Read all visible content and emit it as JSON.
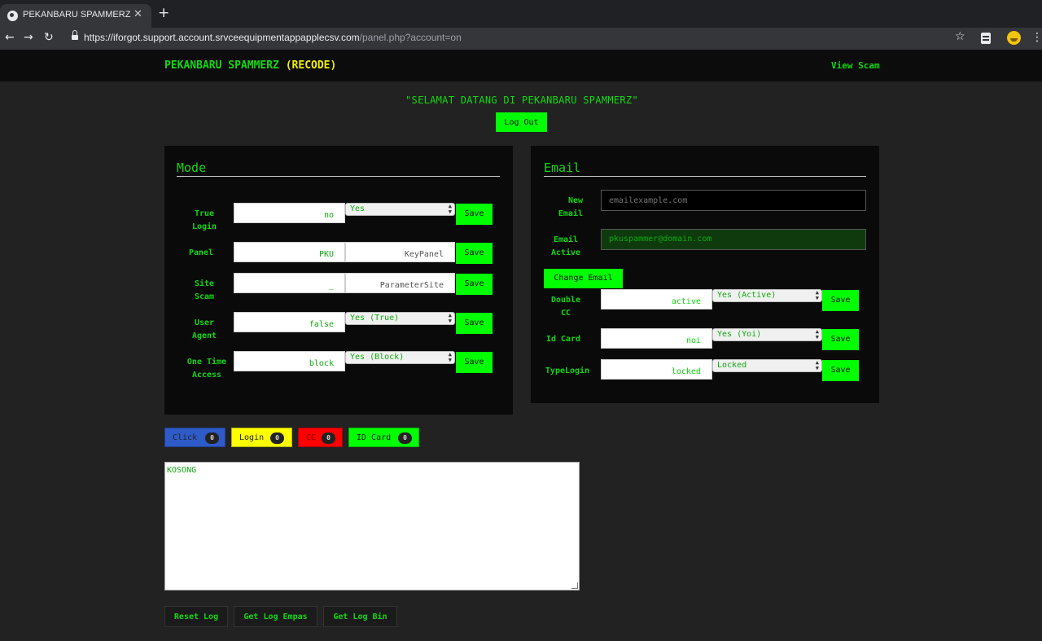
{
  "browser": {
    "tab_title": "PEKANBARU SPAMMERZ",
    "new_tab": "+",
    "close": "✕",
    "url_main": "https://iforgot.support.account.srvceequipmentappapplecsv.com",
    "url_rest": "/panel.php?account=on"
  },
  "nav": {
    "brand": "PEKANBARU SPAMMERZ",
    "brand_suffix": "(RECODE)",
    "view_scam": "View Scam"
  },
  "welcome": "\"SELAMAT DATANG DI PEKANBARU SPAMMERZ\"",
  "logout_label": "Log Out",
  "mode": {
    "title": "Mode",
    "rows": [
      {
        "label": "True Login",
        "value": "no",
        "select": "Yes",
        "save": "Save"
      },
      {
        "label": "Panel",
        "value": "PKU",
        "value2": "KeyPanel",
        "save": "Save"
      },
      {
        "label": "Site Scam",
        "value": "_",
        "value2": "ParameterSite",
        "save": "Save"
      },
      {
        "label": "User Agent",
        "value": "false",
        "select": "Yes (True)",
        "save": "Save"
      },
      {
        "label": "One Time Access",
        "value": "block",
        "select": "Yes (Block)",
        "save": "Save"
      }
    ]
  },
  "email": {
    "title": "Email",
    "new_label": "New Email",
    "new_placeholder": "emailexample.com",
    "active_label": "Email Active",
    "active_value": "pkuspammer@domain.com",
    "change_label": "Change Email",
    "rows": [
      {
        "label": "Double CC",
        "value": "active",
        "select": "Yes (Active)",
        "save": "Save"
      },
      {
        "label": "Id Card",
        "value": "noi",
        "select": "Yes (Yoi)",
        "save": "Save"
      },
      {
        "label": "TypeLogin",
        "value": "locked",
        "select": "Locked",
        "save": "Save"
      }
    ]
  },
  "counters": [
    {
      "label": "Click",
      "count": "0",
      "color": "#2f5bc8"
    },
    {
      "label": "Login",
      "count": "0",
      "color": "#ffff00"
    },
    {
      "label": "CC",
      "count": "0",
      "color": "#ff0000"
    },
    {
      "label": "ID Card",
      "count": "0",
      "color": "#00ff00"
    }
  ],
  "log_text": "KOSONG",
  "log_buttons": {
    "reset": "Reset Log",
    "empas": "Get Log Empas",
    "bin": "Get Log Bin"
  },
  "colors": {
    "accent_green": "#11d811",
    "button_green": "#00ff00",
    "brand_yellow": "#f1ee00",
    "panel_bg": "#0a0a0a",
    "page_bg": "#222222"
  }
}
